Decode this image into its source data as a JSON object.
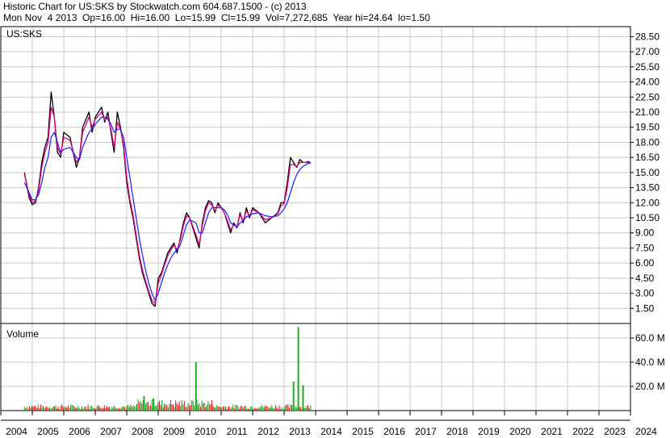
{
  "header": {
    "line1": "Historic Chart for US:SKS by Stockwatch.com 604.687.1500 - (c) 2013",
    "line2": "Mon Nov  4 2013  Op=16.00  Hi=16.00  Lo=15.99  Cl=15.99  Vol=7,272,685  Year hi=24.64  lo=1.50"
  },
  "colors": {
    "price": "#000000",
    "ma_short": "#e0007a",
    "ma_long": "#1a1aff",
    "vol_up": "#22aa22",
    "vol_down": "#dd2222",
    "grid": "#c8c8c8",
    "frame": "#000000"
  },
  "chart_data": [
    {
      "type": "line",
      "panel": "price",
      "label": "US:SKS",
      "y_ticks": [
        "28.50",
        "27.00",
        "25.50",
        "24.00",
        "22.50",
        "21.00",
        "19.50",
        "18.00",
        "16.50",
        "15.00",
        "13.50",
        "12.00",
        "10.50",
        "9.00",
        "7.50",
        "6.00",
        "4.50",
        "3.00",
        "1.50"
      ],
      "ylim": [
        0,
        29.5
      ],
      "grid": true,
      "x": [
        2004.75,
        2004.9,
        2005.0,
        2005.1,
        2005.2,
        2005.3,
        2005.4,
        2005.5,
        2005.6,
        2005.7,
        2005.8,
        2005.9,
        2006.0,
        2006.2,
        2006.4,
        2006.5,
        2006.6,
        2006.8,
        2006.9,
        2007.0,
        2007.2,
        2007.3,
        2007.4,
        2007.5,
        2007.6,
        2007.7,
        2007.8,
        2007.9,
        2008.0,
        2008.1,
        2008.2,
        2008.3,
        2008.4,
        2008.5,
        2008.6,
        2008.7,
        2008.8,
        2008.9,
        2009.0,
        2009.1,
        2009.2,
        2009.3,
        2009.4,
        2009.5,
        2009.6,
        2009.7,
        2009.8,
        2009.9,
        2010.0,
        2010.2,
        2010.3,
        2010.4,
        2010.5,
        2010.6,
        2010.7,
        2010.8,
        2010.9,
        2011.0,
        2011.1,
        2011.2,
        2011.3,
        2011.4,
        2011.5,
        2011.6,
        2011.7,
        2011.8,
        2011.9,
        2012.0,
        2012.2,
        2012.4,
        2012.6,
        2012.8,
        2012.9,
        2013.0,
        2013.1,
        2013.2,
        2013.3,
        2013.4,
        2013.5,
        2013.6,
        2013.7,
        2013.75,
        2013.84
      ],
      "series": [
        {
          "type": "line",
          "role": "price",
          "values": [
            15.0,
            12.5,
            11.8,
            12.0,
            13.5,
            16.0,
            17.5,
            18.5,
            23.0,
            20.5,
            17.0,
            16.5,
            19.0,
            18.5,
            15.5,
            16.5,
            19.5,
            21.0,
            19.0,
            20.5,
            21.5,
            20.0,
            21.0,
            19.0,
            17.0,
            21.0,
            19.5,
            17.5,
            14.0,
            12.0,
            10.5,
            8.5,
            6.5,
            5.0,
            4.0,
            3.0,
            2.0,
            1.7,
            4.5,
            5.0,
            6.0,
            7.0,
            7.5,
            8.0,
            7.0,
            8.5,
            10.0,
            11.0,
            10.5,
            8.5,
            7.5,
            10.0,
            11.5,
            12.2,
            12.0,
            11.0,
            12.0,
            11.5,
            11.0,
            10.0,
            9.0,
            10.0,
            9.5,
            11.0,
            10.0,
            11.5,
            10.5,
            11.5,
            11.0,
            10.0,
            10.5,
            11.0,
            12.0,
            12.0,
            14.0,
            16.5,
            16.0,
            15.5,
            16.3,
            16.0,
            16.0,
            16.1,
            15.99
          ]
        },
        {
          "type": "line",
          "role": "ma_short",
          "values": [
            14.8,
            12.8,
            12.0,
            12.2,
            13.2,
            15.5,
            17.0,
            18.0,
            21.5,
            20.5,
            17.5,
            16.8,
            18.5,
            18.2,
            16.0,
            16.5,
            19.0,
            20.5,
            19.5,
            20.3,
            21.0,
            20.2,
            20.5,
            19.3,
            17.5,
            20.0,
            19.3,
            17.8,
            14.5,
            12.3,
            10.8,
            8.8,
            6.8,
            5.3,
            4.2,
            3.2,
            2.3,
            2.0,
            4.0,
            4.8,
            5.8,
            6.7,
            7.3,
            7.8,
            7.3,
            8.3,
            9.7,
            10.7,
            10.5,
            8.8,
            7.8,
            9.7,
            11.2,
            12.0,
            11.8,
            11.2,
            11.8,
            11.5,
            11.0,
            10.2,
            9.3,
            9.8,
            9.6,
            10.8,
            10.2,
            11.2,
            10.7,
            11.3,
            11.0,
            10.3,
            10.5,
            10.9,
            11.7,
            11.9,
            13.5,
            15.8,
            15.8,
            15.6,
            16.0,
            16.0,
            16.0,
            16.0,
            16.0
          ]
        },
        {
          "type": "line",
          "role": "ma_long",
          "values": [
            14.0,
            13.0,
            12.3,
            12.3,
            12.8,
            14.0,
            15.5,
            16.5,
            18.5,
            19.0,
            18.0,
            17.0,
            17.3,
            17.5,
            16.5,
            16.3,
            17.5,
            19.0,
            19.3,
            19.8,
            20.5,
            20.5,
            20.3,
            19.8,
            19.0,
            19.3,
            19.3,
            18.5,
            16.5,
            14.5,
            12.5,
            10.5,
            8.5,
            6.8,
            5.3,
            4.0,
            3.0,
            2.3,
            3.0,
            4.0,
            5.0,
            5.8,
            6.5,
            7.0,
            7.3,
            7.8,
            8.8,
            9.8,
            10.3,
            10.0,
            9.0,
            9.0,
            10.0,
            11.0,
            11.5,
            11.5,
            11.5,
            11.5,
            11.3,
            10.8,
            10.0,
            9.8,
            9.6,
            10.0,
            10.2,
            10.6,
            10.7,
            10.9,
            11.0,
            10.7,
            10.6,
            10.7,
            11.0,
            11.4,
            12.0,
            13.0,
            14.0,
            14.8,
            15.3,
            15.6,
            15.8,
            15.9,
            15.9
          ]
        }
      ]
    },
    {
      "type": "bar",
      "panel": "volume",
      "label": "Volume",
      "y_ticks": [
        "60.0 M",
        "40.0 M",
        "20.0 M"
      ],
      "ylim": [
        0,
        72
      ],
      "grid": true,
      "volume_seed": 7,
      "volume_count": 230,
      "volume_base": 2.5,
      "spikes": [
        {
          "x": 2008.55,
          "value": 12.0
        },
        {
          "x": 2008.85,
          "value": 10.0
        },
        {
          "x": 2010.2,
          "value": 40.0
        },
        {
          "x": 2013.3,
          "value": 24.0
        },
        {
          "x": 2013.45,
          "value": 69.0
        },
        {
          "x": 2013.6,
          "value": 21.0
        }
      ]
    }
  ],
  "x_axis": {
    "labels": [
      "2004",
      "2005",
      "2006",
      "2007",
      "2008",
      "2009",
      "2010",
      "2011",
      "2012",
      "2013",
      "2014",
      "2015",
      "2016",
      "2017",
      "2018",
      "2019",
      "2020",
      "2021",
      "2022",
      "2023",
      "2024"
    ],
    "range": [
      2004,
      2024
    ]
  }
}
